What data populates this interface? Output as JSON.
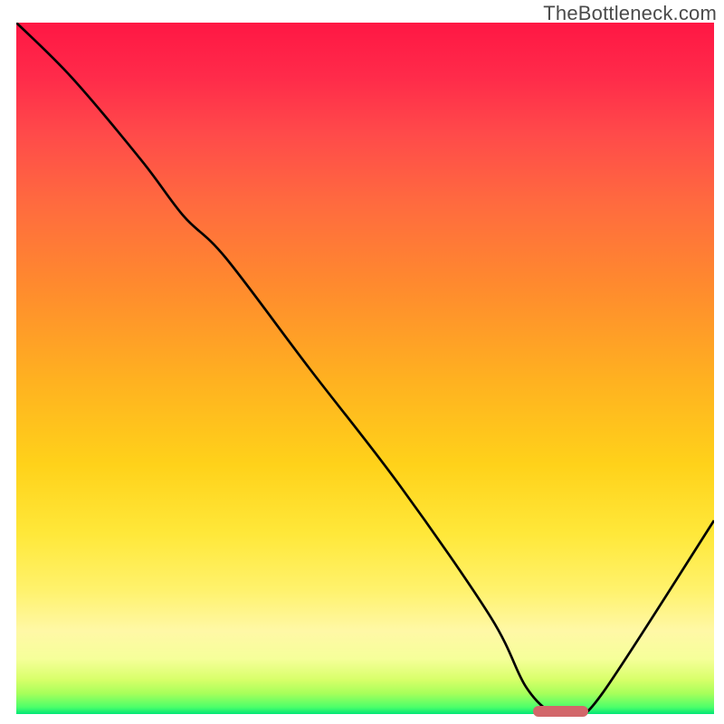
{
  "watermark": "TheBottleneck.com",
  "chart_data": {
    "type": "line",
    "title": "",
    "xlabel": "",
    "ylabel": "",
    "xlim": [
      0,
      100
    ],
    "ylim": [
      0,
      100
    ],
    "x": [
      0,
      8,
      18,
      24,
      30,
      42,
      55,
      68,
      73,
      77,
      80,
      84,
      100
    ],
    "values": [
      100,
      92,
      80,
      72,
      66,
      50,
      33,
      14,
      4,
      0,
      0,
      3,
      28
    ],
    "optimum_marker": {
      "x_start": 74,
      "x_end": 82,
      "y": 0.4
    },
    "background_gradient": {
      "top_color": "#ff1744",
      "mid_color": "#ffd21a",
      "bottom_color": "#00e676"
    }
  },
  "colors": {
    "curve": "#000000",
    "marker": "#d2676a",
    "watermark": "#4a4a4a"
  }
}
